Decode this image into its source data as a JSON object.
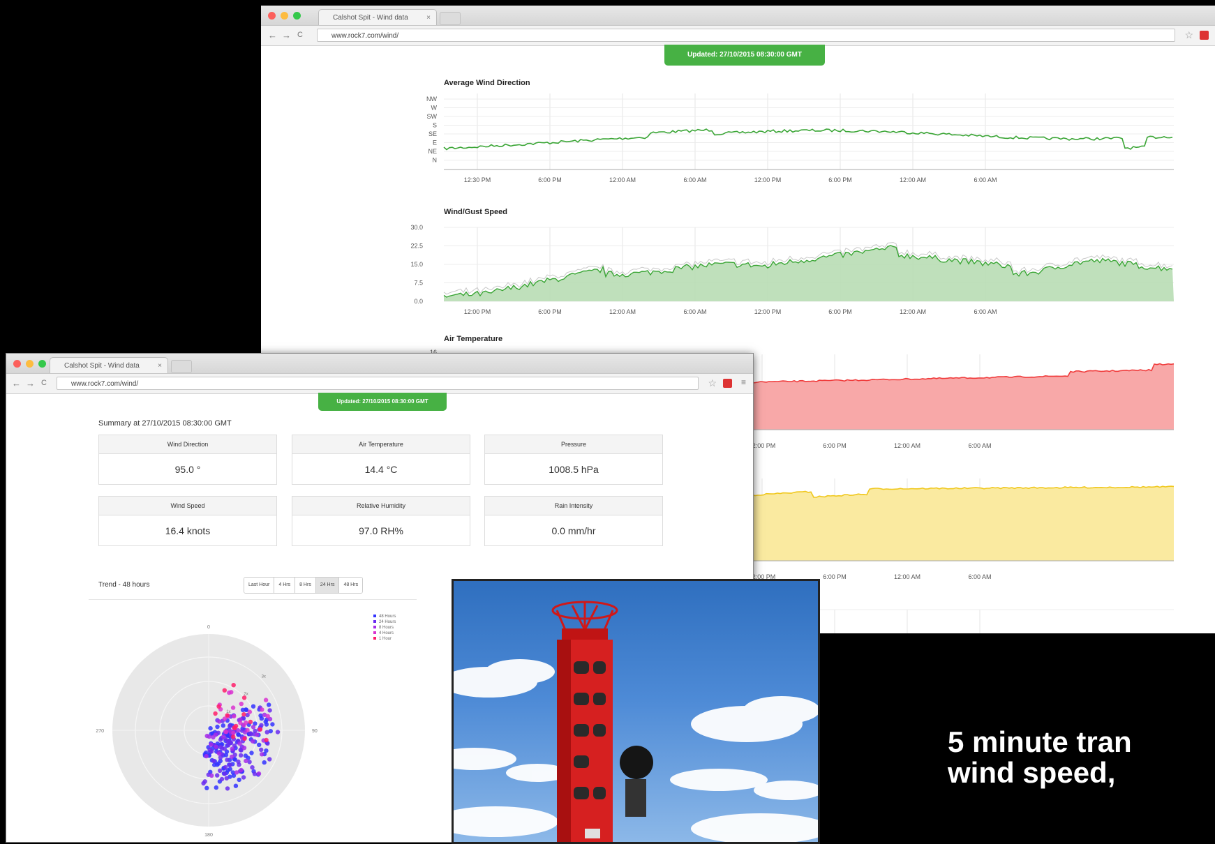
{
  "browser_back": {
    "tab_title": "Calshot Spit - Wind data",
    "tab_close": "×",
    "url": "www.rock7.com/wind/",
    "nav": {
      "back": "←",
      "forward": "→",
      "reload": "C"
    },
    "star": "☆",
    "updated": "Updated: 27/10/2015 08:30:00 GMT",
    "charts": {
      "wind_direction": {
        "title": "Average Wind Direction",
        "y_ticks": [
          "NW",
          "W",
          "SW",
          "S",
          "SE",
          "E",
          "NE",
          "N"
        ],
        "x_ticks": [
          "12:30 PM",
          "6:00 PM",
          "12:00 AM",
          "6:00 AM",
          "12:00 PM",
          "6:00 PM",
          "12:00 AM",
          "6:00 AM"
        ],
        "color": "#3aa535"
      },
      "wind_speed": {
        "title": "Wind/Gust Speed",
        "y_ticks": [
          "30.0",
          "22.5",
          "15.0",
          "7.5",
          "0.0"
        ],
        "x_ticks": [
          "12:00 PM",
          "6:00 PM",
          "12:00 AM",
          "6:00 AM",
          "12:00 PM",
          "6:00 PM",
          "12:00 AM",
          "6:00 AM"
        ],
        "color": "#3aa535"
      },
      "air_temperature": {
        "title": "Air Temperature",
        "y_ticks": [
          "16"
        ],
        "x_ticks": [
          "12:00 PM",
          "6:00 PM",
          "12:00 AM",
          "6:00 AM"
        ],
        "color": "#f03c3c"
      },
      "humidity": {
        "x_ticks": [
          "12:00 PM",
          "6:00 PM",
          "12:00 AM",
          "6:00 AM"
        ],
        "color": "#f0c81e"
      }
    }
  },
  "browser_front": {
    "tab_title": "Calshot Spit - Wind data",
    "tab_close": "×",
    "url": "www.rock7.com/wind/",
    "nav": {
      "back": "←",
      "forward": "→",
      "reload": "C"
    },
    "star": "☆",
    "menu": "≡",
    "updated": "Updated: 27/10/2015 08:30:00 GMT",
    "summary_title": "Summary at 27/10/2015 08:30:00 GMT",
    "cards": [
      {
        "label": "Wind Direction",
        "value": "95.0 °"
      },
      {
        "label": "Air Temperature",
        "value": "14.4 °C"
      },
      {
        "label": "Pressure",
        "value": "1008.5 hPa"
      },
      {
        "label": "Wind Speed",
        "value": "16.4 knots"
      },
      {
        "label": "Relative Humidity",
        "value": "97.0 RH%"
      },
      {
        "label": "Rain Intensity",
        "value": "0.0 mm/hr"
      }
    ],
    "trend_title": "Trend - 48 hours",
    "trend_buttons": [
      "Last Hour",
      "4 Hrs",
      "8 Hrs",
      "24 Hrs",
      "48 Hrs"
    ],
    "active_button": "24 Hrs",
    "polar": {
      "angle_labels": [
        "0",
        "90",
        "180",
        "270"
      ],
      "radius_labels": [
        "1x",
        "2x",
        "3x"
      ],
      "legend": [
        {
          "label": "48 Hours",
          "color": "#3333ff"
        },
        {
          "label": "24 Hours",
          "color": "#6a2cf0"
        },
        {
          "label": "8 Hours",
          "color": "#a52ce8"
        },
        {
          "label": "4 Hours",
          "color": "#d932d0"
        },
        {
          "label": "1 Hour",
          "color": "#ff1d6a"
        }
      ]
    }
  },
  "caption": {
    "line1": "5 minute tran",
    "line2": "wind speed,"
  }
}
